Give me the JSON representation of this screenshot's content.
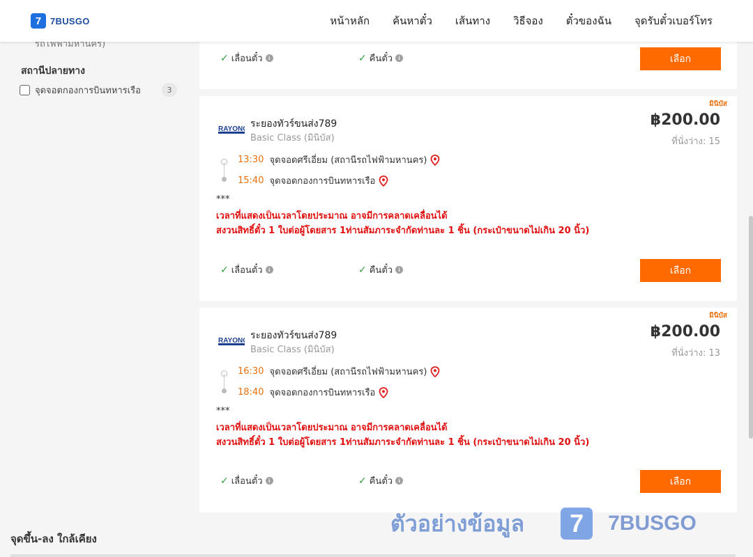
{
  "brand": {
    "logo_mark": "7",
    "logo_text": "7BUSGO"
  },
  "nav": [
    "หน้าหลัก",
    "ค้นหาตั๋ว",
    "เส้นทาง",
    "วิธีจอง",
    "ตั๋วของฉัน",
    "จุดรับตั๋วเบอร์โทร"
  ],
  "sidebar": {
    "cutoff_text": "รถไฟฟ้ามหานคร)",
    "section_title": "สถานีปลายทาง",
    "option_label": "จุดจอดกองการบินทหารเรือ",
    "option_count": "3",
    "nearby_title": "จุดขึ้น-ลง ใกล้เคียง"
  },
  "features": {
    "change": "เลื่อนตั๋ว",
    "refund": "คืนตั๋ว",
    "info_glyph": "i",
    "check_glyph": "✓"
  },
  "select_label": "เลือก",
  "trips": [
    {
      "tag": "มินิบัส",
      "operator": "ระยองทัวร์ขนส่ง789",
      "operator_logo": "RAYONG",
      "class": "Basic Class (มินิบัส)",
      "price": "฿200.00",
      "seats": "ที่นั่งว่าง: 15",
      "dep_time": "13:30",
      "dep_stop": "จุดจอดศรีเอี่ยม (สถานีรถไฟฟ้ามหานคร)",
      "arr_time": "15:40",
      "arr_stop": "จุดจอดกองการบินทหารเรือ",
      "note_stars": "***",
      "note_1": "เวลาที่แสดงเป็นเวลาโดยประมาณ อาจมีการคลาดเคลื่อนได้",
      "note_2": "สงวนสิทธิ์ตั๋ว 1 ใบต่อผู้โดยสาร 1ท่านสัมภาระจำกัดท่านละ 1 ชิ้น (กระเป๋าขนาดไม่เกิน 20 นิ้ว)"
    },
    {
      "tag": "มินิบัส",
      "operator": "ระยองทัวร์ขนส่ง789",
      "operator_logo": "RAYONG",
      "class": "Basic Class (มินิบัส)",
      "price": "฿200.00",
      "seats": "ที่นั่งว่าง: 13",
      "dep_time": "16:30",
      "dep_stop": "จุดจอดศรีเอี่ยม (สถานีรถไฟฟ้ามหานคร)",
      "arr_time": "18:40",
      "arr_stop": "จุดจอดกองการบินทหารเรือ",
      "note_stars": "***",
      "note_1": "เวลาที่แสดงเป็นเวลาโดยประมาณ อาจมีการคลาดเคลื่อนได้",
      "note_2": "สงวนสิทธิ์ตั๋ว 1 ใบต่อผู้โดยสาร 1ท่านสัมภาระจำกัดท่านละ 1 ชิ้น (กระเป๋าขนาดไม่เกิน 20 นิ้ว)"
    }
  ],
  "watermark": {
    "text": "ตัวอย่างข้อมูล",
    "logo_mark": "7",
    "brand": "7BUSGO"
  },
  "colors": {
    "accent": "#ff6a00",
    "time": "#e8700d",
    "warning": "#e01010",
    "check": "#2e9b3c",
    "brand_blue": "#1e6fe0"
  },
  "icons": [
    "check-icon",
    "info-icon",
    "map-pin-icon",
    "checkbox-icon"
  ]
}
